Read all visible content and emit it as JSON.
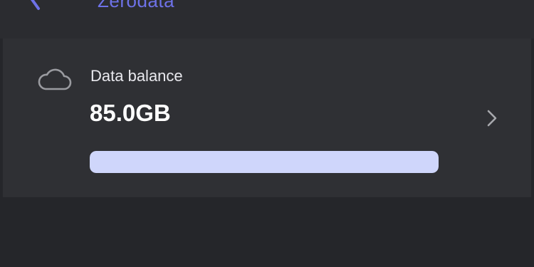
{
  "header": {
    "back_icon": "chevron-left-icon",
    "title": "Zerodata"
  },
  "data_card": {
    "icon": "cloud-icon",
    "label": "Data balance",
    "value": "85.0GB",
    "progress_fraction": 1.0,
    "chevron_icon": "chevron-right-icon"
  },
  "colors": {
    "accent": "#6e72e8",
    "progress_fill": "#cfd6fb",
    "card_background": "#2f3034",
    "page_background": "#25262a"
  }
}
